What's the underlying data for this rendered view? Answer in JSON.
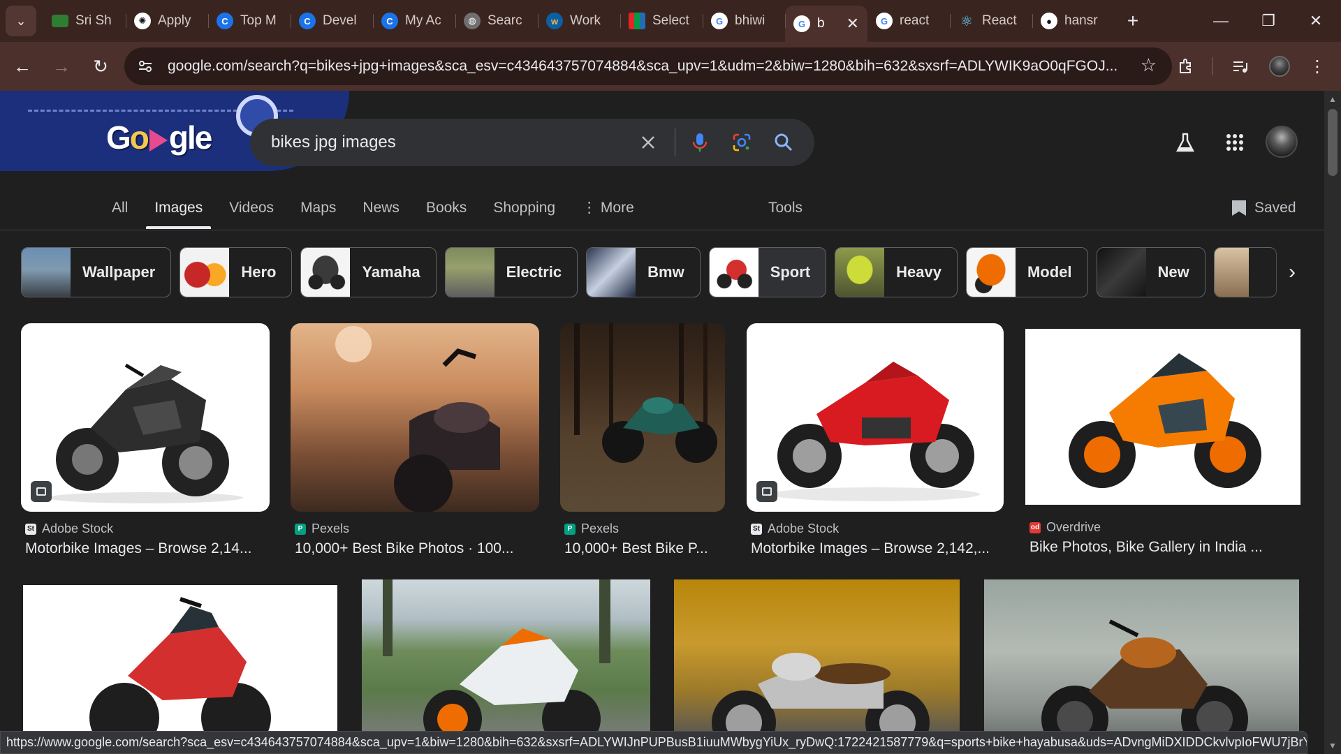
{
  "browser": {
    "tabs": [
      {
        "label": "Sri Sh",
        "icon": "plant-favicon-icon"
      },
      {
        "label": "Apply",
        "icon": "chatgpt-favicon-icon"
      },
      {
        "label": "Top M",
        "icon": "c-favicon-icon"
      },
      {
        "label": "Devel",
        "icon": "c-favicon-icon"
      },
      {
        "label": "My Ac",
        "icon": "c-favicon-icon"
      },
      {
        "label": "Searc",
        "icon": "globe-favicon-icon"
      },
      {
        "label": "Work",
        "icon": "workday-favicon-icon"
      },
      {
        "label": "Select",
        "icon": "zoho-favicon-icon"
      },
      {
        "label": "bhiwi",
        "icon": "google-favicon-icon"
      },
      {
        "label": "b",
        "icon": "google-favicon-icon",
        "active": true
      },
      {
        "label": "react",
        "icon": "google-favicon-icon"
      },
      {
        "label": "React",
        "icon": "react-favicon-icon"
      },
      {
        "label": "hansr",
        "icon": "github-favicon-icon"
      }
    ],
    "url": "google.com/search?q=bikes+jpg+images&sca_esv=c434643757074884&sca_upv=1&udm=2&biw=1280&bih=632&sxsrf=ADLYWIK9aO0qFGOJ...",
    "status_url": "https://www.google.com/search?sca_esv=c434643757074884&sca_upv=1&biw=1280&bih=632&sxsrf=ADLYWIJnPUPBusB1iuuMWbygYiUx_ryDwQ:1722421587779&q=sports+bike+hayabusa&uds=ADvngMiDXIDDCkvlvpIoFWU7jBrY..."
  },
  "search": {
    "query": "bikes jpg images"
  },
  "nav": {
    "tabs": [
      "All",
      "Images",
      "Videos",
      "Maps",
      "News",
      "Books",
      "Shopping"
    ],
    "active": "Images",
    "more_label": "More",
    "tools_label": "Tools",
    "saved_label": "Saved"
  },
  "chips": [
    "Wallpaper",
    "Hero",
    "Yamaha",
    "Electric",
    "Bmw",
    "Sport",
    "Heavy",
    "Model",
    "New"
  ],
  "chip_selected": "Sport",
  "results": [
    {
      "source": "Adobe Stock",
      "title": "Motorbike Images – Browse 2,14...",
      "badge": true
    },
    {
      "source": "Pexels",
      "title": "10,000+ Best Bike Photos · 100...",
      "badge": false
    },
    {
      "source": "Pexels",
      "title": "10,000+ Best Bike P...",
      "badge": false
    },
    {
      "source": "Adobe Stock",
      "title": "Motorbike Images – Browse 2,142,...",
      "badge": true
    },
    {
      "source": "Overdrive",
      "title": "Bike Photos, Bike Gallery in India ...",
      "badge": false
    }
  ],
  "colors": {
    "tab_strip": "#3a2420",
    "toolbar": "#4c302b",
    "page_bg": "#1f1f1f",
    "search_bg": "#303134",
    "accent_blue": "#8ab4f8",
    "google_red": "#ea4335",
    "google_yellow": "#fbbc04",
    "google_green": "#34a853",
    "google_blue": "#4285f4"
  }
}
